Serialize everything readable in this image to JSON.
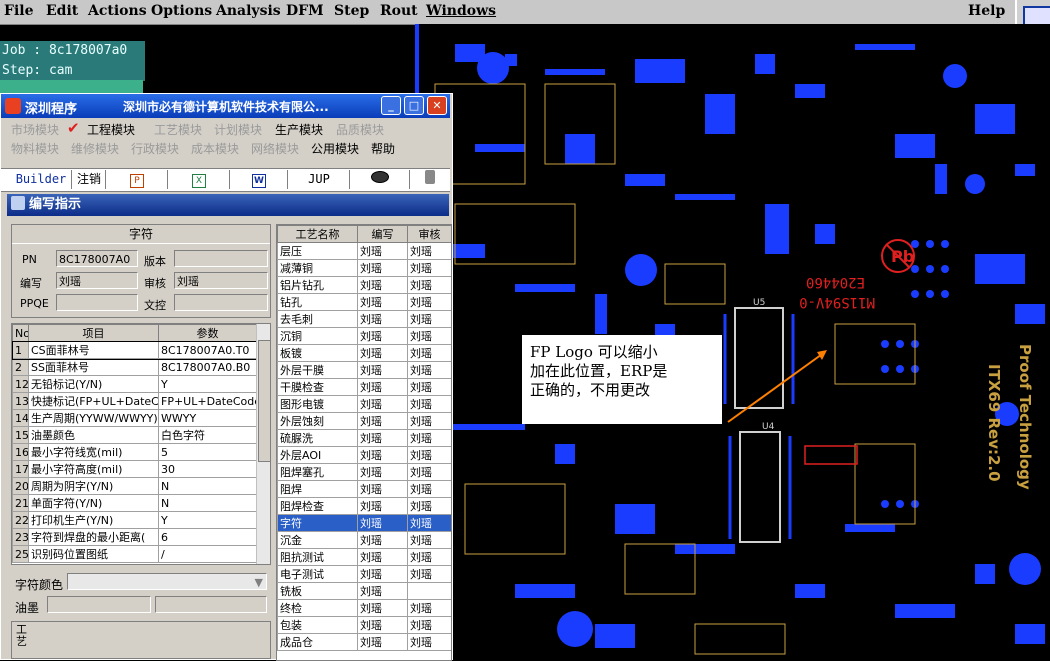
{
  "menubar": {
    "items": [
      "File",
      "Edit",
      "Actions",
      "Options",
      "Analysis",
      "DFM",
      "Step",
      "Rout",
      "Windows"
    ],
    "help": "Help"
  },
  "status": {
    "job": "Job : 8c178007a0",
    "step": "Step: cam"
  },
  "window": {
    "title": "深圳程序",
    "company": "深圳市必有德计算机软件技术有限公...",
    "controls": [
      "_",
      "□",
      "✕"
    ]
  },
  "modules": {
    "row1": [
      "市场模块",
      "工程模块",
      "工艺模块",
      "计划模块",
      "生产模块",
      "品质模块"
    ],
    "row2": [
      "物料模块",
      "维修模块",
      "行政模块",
      "成本模块",
      "网络模块",
      "公用模块",
      "帮助"
    ]
  },
  "toolbar": {
    "builder": "Builder",
    "logout": "注销",
    "jup": "JUP"
  },
  "subwindow": {
    "title": "编写指示"
  },
  "info": {
    "header": "字符",
    "pn_label": "PN",
    "pn_value": "8C178007A0",
    "version_label": "版本",
    "version_value": "",
    "writer_label": "编写",
    "writer_value": "刘瑶",
    "reviewer_label": "审核",
    "reviewer_value": "刘瑶",
    "ppqe_label": "PPQE",
    "ppqe_value": "",
    "doc_label": "文控",
    "doc_value": ""
  },
  "params": {
    "headers": [
      "No",
      "项目",
      "参数"
    ],
    "rows": [
      [
        "1",
        "CS面菲林号",
        "8C178007A0.T0"
      ],
      [
        "2",
        "SS面菲林号",
        "8C178007A0.B0"
      ],
      [
        "12",
        "无铅标记(Y/N)",
        "Y"
      ],
      [
        "13",
        "快捷标记(FP+UL+DateCo",
        "FP+UL+DateCode"
      ],
      [
        "14",
        "生产周期(YYWW/WWYY)",
        "WWYY"
      ],
      [
        "15",
        "油墨颜色",
        "白色字符"
      ],
      [
        "16",
        "最小字符线宽(mil)",
        "5"
      ],
      [
        "17",
        "最小字符高度(mil)",
        "30"
      ],
      [
        "20",
        "周期为阴字(Y/N)",
        "N"
      ],
      [
        "21",
        "单面字符(Y/N)",
        "N"
      ],
      [
        "22",
        "打印机生产(Y/N)",
        "Y"
      ],
      [
        "23",
        "字符到焊盘的最小距离(",
        "6"
      ],
      [
        "25",
        "识别码位置图纸",
        "/"
      ]
    ]
  },
  "bottom": {
    "color_label": "字符颜色",
    "ink_label": "油墨",
    "side_label": "工艺"
  },
  "process": {
    "headers": [
      "工艺名称",
      "编写",
      "审核"
    ],
    "rows": [
      [
        "层压",
        "刘瑶",
        "刘瑶"
      ],
      [
        "减薄铜",
        "刘瑶",
        "刘瑶"
      ],
      [
        "铝片钻孔",
        "刘瑶",
        "刘瑶"
      ],
      [
        "钻孔",
        "刘瑶",
        "刘瑶"
      ],
      [
        "去毛刺",
        "刘瑶",
        "刘瑶"
      ],
      [
        "沉铜",
        "刘瑶",
        "刘瑶"
      ],
      [
        "板镀",
        "刘瑶",
        "刘瑶"
      ],
      [
        "外层干膜",
        "刘瑶",
        "刘瑶"
      ],
      [
        "干膜检查",
        "刘瑶",
        "刘瑶"
      ],
      [
        "图形电镀",
        "刘瑶",
        "刘瑶"
      ],
      [
        "外层蚀刻",
        "刘瑶",
        "刘瑶"
      ],
      [
        "硫脲洗",
        "刘瑶",
        "刘瑶"
      ],
      [
        "外层AOI",
        "刘瑶",
        "刘瑶"
      ],
      [
        "阻焊塞孔",
        "刘瑶",
        "刘瑶"
      ],
      [
        "阻焊",
        "刘瑶",
        "刘瑶"
      ],
      [
        "阻焊检查",
        "刘瑶",
        "刘瑶"
      ],
      [
        "字符",
        "刘瑶",
        "刘瑶"
      ],
      [
        "沉金",
        "刘瑶",
        "刘瑶"
      ],
      [
        "阻抗测试",
        "刘瑶",
        "刘瑶"
      ],
      [
        "电子测试",
        "刘瑶",
        "刘瑶"
      ],
      [
        "铣板",
        "刘瑶",
        ""
      ],
      [
        "终检",
        "刘瑶",
        "刘瑶"
      ],
      [
        "包装",
        "刘瑶",
        "刘瑶"
      ],
      [
        "成品仓",
        "刘瑶",
        "刘瑶"
      ]
    ],
    "selected_index": 16
  },
  "pcb": {
    "labels": [
      "E204460",
      "M11S94V-0",
      "U5",
      "U4",
      "Proof Technology",
      "ITX69 Rev:2.0"
    ],
    "accent": "#1a3cff"
  },
  "note": {
    "lines": [
      "FP Logo 可以缩小",
      "加在此位置，ERP是",
      "正确的，不用更改"
    ]
  }
}
